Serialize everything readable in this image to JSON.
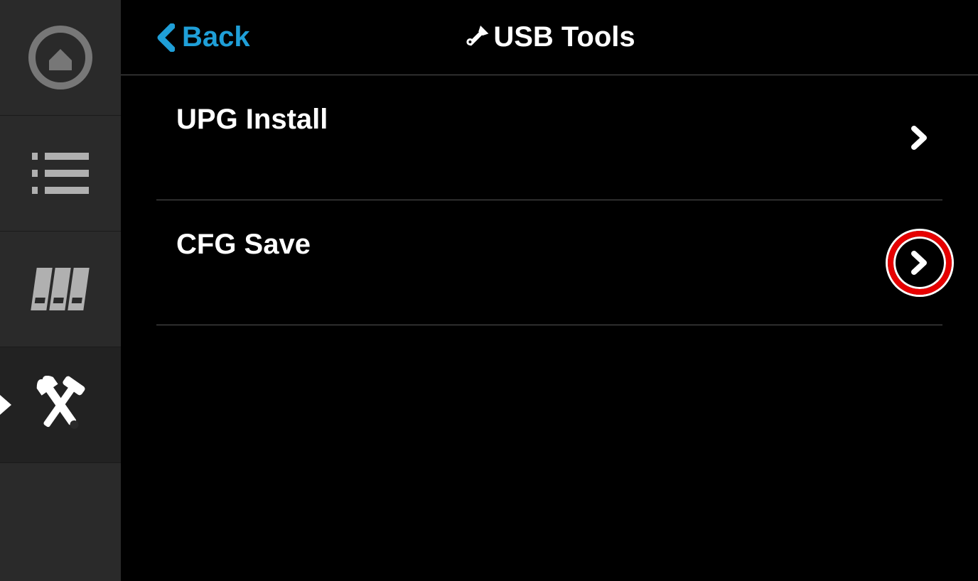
{
  "header": {
    "back_label": "Back",
    "title": "USB Tools"
  },
  "sidebar": {
    "items": [
      {
        "icon": "home-icon"
      },
      {
        "icon": "list-icon"
      },
      {
        "icon": "servers-icon"
      },
      {
        "icon": "tools-icon",
        "active": true
      }
    ]
  },
  "list": {
    "rows": [
      {
        "label": "UPG Install",
        "highlighted": false
      },
      {
        "label": "CFG Save",
        "highlighted": true
      }
    ]
  },
  "colors": {
    "accent": "#1f9fd8",
    "highlight": "#e60000"
  }
}
